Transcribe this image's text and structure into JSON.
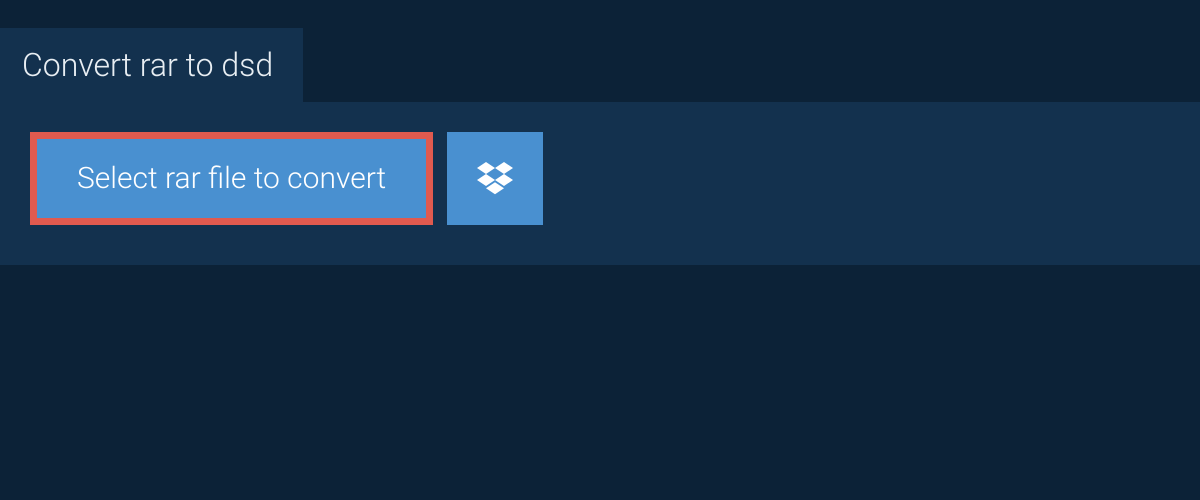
{
  "header": {
    "title": "Convert rar to dsd"
  },
  "actions": {
    "select_file_label": "Select rar file to convert",
    "dropbox_icon": "dropbox-icon"
  },
  "colors": {
    "background": "#0c2237",
    "panel": "#13314e",
    "button_primary": "#4990d0",
    "highlight_border": "#e05a4f",
    "text_light": "#ffffff"
  }
}
